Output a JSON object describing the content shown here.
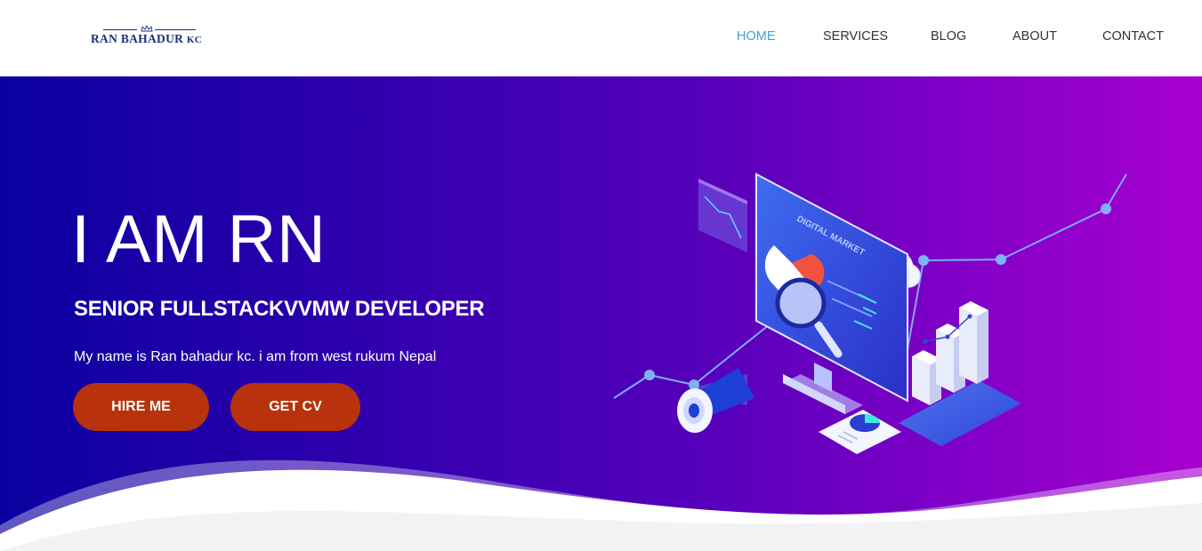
{
  "header": {
    "logo": {
      "name_main": "RAN BAHADUR",
      "name_suffix": "KC"
    },
    "nav": [
      {
        "label": "HOME",
        "active": true
      },
      {
        "label": "SERVICES",
        "active": false
      },
      {
        "label": "BLOG",
        "active": false
      },
      {
        "label": "ABOUT",
        "active": false
      },
      {
        "label": "CONTACT",
        "active": false
      }
    ]
  },
  "hero": {
    "title": "I AM RN",
    "subtitle": "SENIOR FULLSTACKVVMW DEVELOPER",
    "description": "My name is Ran bahadur kc. i am from west rukum Nepal",
    "buttons": {
      "hire": "HIRE ME",
      "cv": "GET CV"
    },
    "illustration": {
      "screen_label": "DIGITAL MARKET",
      "icons": [
        "monitor-icon",
        "cloud-icon",
        "megaphone-icon",
        "magnifier-icon",
        "bar-chart-icon",
        "pie-chart-icon",
        "line-chart-icon"
      ]
    }
  },
  "colors": {
    "nav_active": "#3ea0d8",
    "nav_text": "#333333",
    "logo": "#1b2f7e",
    "button_bg": "#b7320d",
    "hero_gradient_start": "#0a00a0",
    "hero_gradient_end": "#a800d0"
  }
}
